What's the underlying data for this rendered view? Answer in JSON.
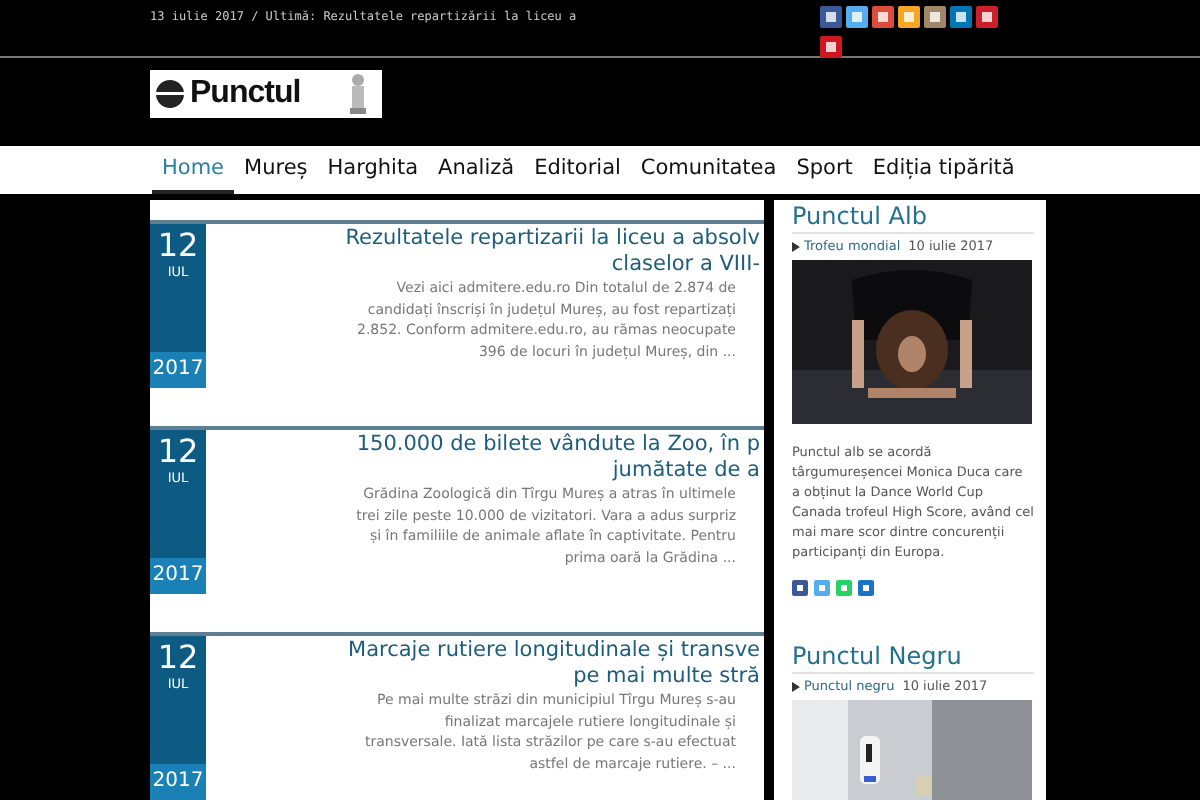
{
  "topbar": {
    "ticker": "13 iulie 2017 / Ultimă: Rezultatele repartizării la liceu a",
    "social": [
      {
        "color": "#3b5998"
      },
      {
        "color": "#55acee"
      },
      {
        "color": "#dd4b39"
      },
      {
        "color": "#f5a623"
      },
      {
        "color": "#a0876a"
      },
      {
        "color": "#0077b5"
      },
      {
        "color": "#cb2027"
      },
      {
        "color": "#cc181e"
      }
    ]
  },
  "logo": {
    "text": "Punctul"
  },
  "nav": [
    {
      "label": "Home",
      "selected": true
    },
    {
      "label": "Mureș",
      "selected": false
    },
    {
      "label": "Harghita",
      "selected": false
    },
    {
      "label": "Analiză",
      "selected": false
    },
    {
      "label": "Editorial",
      "selected": false
    },
    {
      "label": "Comunitatea",
      "selected": false
    },
    {
      "label": "Sport",
      "selected": false
    },
    {
      "label": "Ediția tipărită",
      "selected": false
    }
  ],
  "articles": [
    {
      "day": "12",
      "month": "IUL",
      "year": "2017",
      "title_lines": [
        "Rezultatele repartizarii la liceu a absolv",
        "claselor a VIII-"
      ],
      "excerpt_lines": [
        "Vezi aici admitere.edu.ro Din totalul de 2.874 de",
        "candidați înscriși în județul Mureș, au fost repartizați",
        "2.852. Conform admitere.edu.ro, au rămas neocupate",
        "396 de locuri în județul Mureș, din ..."
      ]
    },
    {
      "day": "12",
      "month": "IUL",
      "year": "2017",
      "title_lines": [
        "150.000 de bilete vândute la Zoo, în p",
        "jumătate de a"
      ],
      "excerpt_lines": [
        "Grădina Zoologică din Tîrgu Mureș a atras în ultimele",
        "trei zile peste 10.000 de vizitatori. Vara a adus surpriz",
        "și în familiile de animale aflate în captivitate. Pentru",
        "prima oară la Grădina ..."
      ]
    },
    {
      "day": "12",
      "month": "IUL",
      "year": "2017",
      "title_lines": [
        "Marcaje rutiere longitudinale și transve",
        "pe mai multe stră"
      ],
      "excerpt_lines": [
        "Pe mai multe străzi din municipiul Tîrgu Mureș s-au",
        "finalizat marcajele rutiere longitudinale și",
        "transversale. Iată lista străzilor pe care s-au efectuat",
        "astfel de marcaje rutiere. – ..."
      ]
    }
  ],
  "sidebar": [
    {
      "heading": "Punctul Alb",
      "link": "Trofeu mondial",
      "date": "10 iulie 2017",
      "text": "Punctul alb se acordă târgumureșencei Monica Duca care a obținut la Dance World Cup Canada trofeul High Score, având cel mai mare scor dintre concurenții participanți din Europa.",
      "share": [
        {
          "color": "#3b5998"
        },
        {
          "color": "#55acee"
        },
        {
          "color": "#25d366"
        },
        {
          "color": "#1a73c8"
        }
      ]
    },
    {
      "heading": "Punctul Negru",
      "link": "Punctul negru",
      "date": "10 iulie 2017"
    }
  ]
}
